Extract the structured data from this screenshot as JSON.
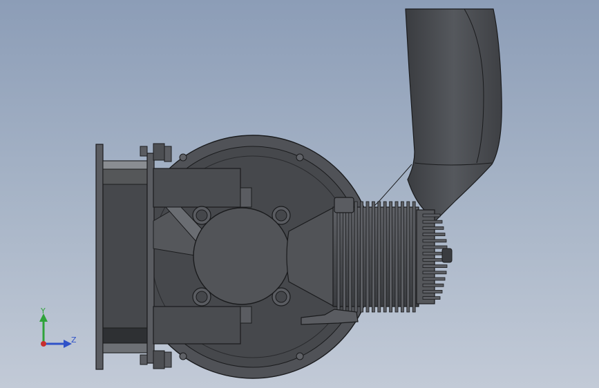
{
  "viewport": {
    "background_top": "#8c9db7",
    "background_bottom": "#c2cad7"
  },
  "model": {
    "parts": [
      "mounting-flange",
      "crankcase",
      "engine-mount-arms",
      "crankshaft-hub",
      "cylinder",
      "cooling-fins",
      "cylinder-head",
      "exhaust-pipe",
      "spark-plug",
      "carburetor-lever"
    ],
    "colors": {
      "body": "#4d4f53",
      "dark": "#2d2f33",
      "mid": "#5a5c61",
      "light": "#6d7075",
      "outline": "#1a1b1d"
    }
  },
  "triad": {
    "y_label": "Y",
    "z_label": "Z",
    "y_color": "#2fa33a",
    "z_color": "#2f52c8",
    "x_color": "#c82f2f"
  }
}
